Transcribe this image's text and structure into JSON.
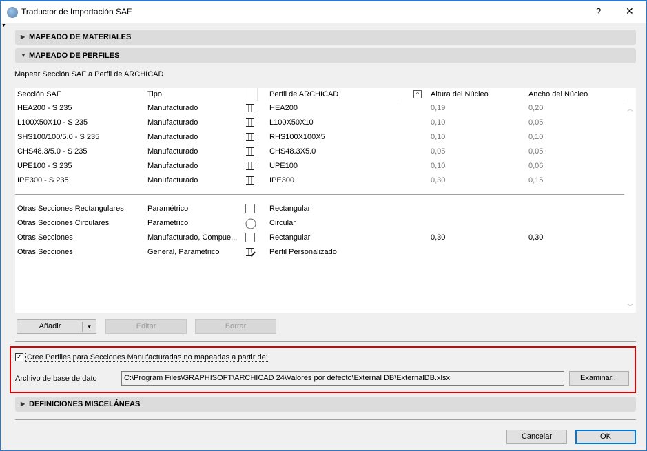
{
  "window": {
    "title": "Traductor de Importación SAF",
    "help": "?",
    "close": "✕"
  },
  "sections": {
    "materials": "MAPEADO DE MATERIALES",
    "profiles": "MAPEADO DE PERFILES",
    "misc": "DEFINICIONES MISCELÁNEAS"
  },
  "profiles": {
    "subtitle": "Mapear Sección SAF a Perfil de ARCHICAD",
    "columns": [
      "Sección SAF",
      "Tipo",
      "",
      "Perfil de ARCHICAD",
      "",
      "Altura del Núcleo",
      "Ancho del Núcleo"
    ],
    "rows": [
      {
        "saf": "HEA200 - S 235",
        "tipo": "Manufacturado",
        "icon": "i-beam",
        "perfil": "HEA200",
        "altura": "0,19",
        "ancho": "0,20"
      },
      {
        "saf": "L100X50X10 - S 235",
        "tipo": "Manufacturado",
        "icon": "i-beam",
        "perfil": "L100X50X10",
        "altura": "0,10",
        "ancho": "0,05"
      },
      {
        "saf": "SHS100/100/5.0 - S 235",
        "tipo": "Manufacturado",
        "icon": "i-beam",
        "perfil": "RHS100X100X5",
        "altura": "0,10",
        "ancho": "0,10"
      },
      {
        "saf": "CHS48.3/5.0 - S 235",
        "tipo": "Manufacturado",
        "icon": "i-beam",
        "perfil": "CHS48.3X5.0",
        "altura": "0,05",
        "ancho": "0,05"
      },
      {
        "saf": "UPE100 - S 235",
        "tipo": "Manufacturado",
        "icon": "i-beam",
        "perfil": "UPE100",
        "altura": "0,10",
        "ancho": "0,06"
      },
      {
        "saf": "IPE300 - S 235",
        "tipo": "Manufacturado",
        "icon": "i-beam",
        "perfil": "IPE300",
        "altura": "0,30",
        "ancho": "0,15"
      }
    ],
    "other_rows": [
      {
        "saf": "Otras Secciones Rectangulares",
        "tipo": "Paramétrico",
        "icon": "rectangle",
        "perfil": "Rectangular",
        "altura": "",
        "ancho": ""
      },
      {
        "saf": "Otras Secciones Circulares",
        "tipo": "Paramétrico",
        "icon": "circle",
        "perfil": "Circular",
        "altura": "",
        "ancho": ""
      },
      {
        "saf": "Otras Secciones",
        "tipo": "Manufacturado, Compue...",
        "icon": "rectangle",
        "perfil": "Rectangular",
        "altura": "0,30",
        "ancho": "0,30"
      },
      {
        "saf": "Otras Secciones",
        "tipo": "General, Paramétrico",
        "icon": "custom-profile",
        "perfil": "Perfil Personalizado",
        "altura": "",
        "ancho": ""
      }
    ],
    "buttons": {
      "add": "Añadir",
      "edit": "Editar",
      "delete": "Borrar"
    }
  },
  "database": {
    "checkbox_label": "Cree Perfiles para Secciones Manufacturadas no mapeadas a partir de:",
    "checked": true,
    "file_label": "Archivo de base de dato",
    "file_path": "C:\\Program Files\\GRAPHISOFT\\ARCHICAD 24\\Valores por defecto\\External DB\\ExternalDB.xlsx",
    "browse": "Examinar..."
  },
  "footer": {
    "cancel": "Cancelar",
    "ok": "OK"
  },
  "colors": {
    "highlight": "#e00000",
    "accent": "#0078d7"
  }
}
